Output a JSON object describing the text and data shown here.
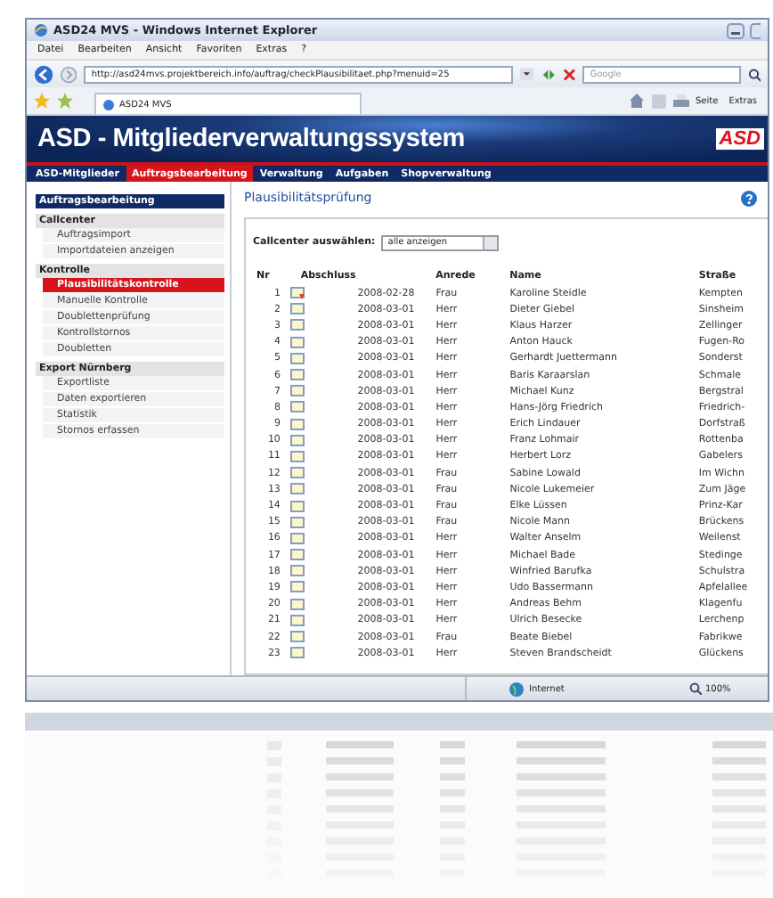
{
  "window": {
    "title": "ASD24 MVS - Windows Internet Explorer"
  },
  "menu": [
    "Datei",
    "Bearbeiten",
    "Ansicht",
    "Favoriten",
    "Extras",
    "?"
  ],
  "address": {
    "url": "http://asd24mvs.projektbereich.info/auftrag/checkPlausibilitaet.php?menuid=25",
    "search_placeholder": "Google"
  },
  "browser_tab": {
    "title": "ASD24 MVS"
  },
  "toolbar": [
    "Seite",
    "Extras"
  ],
  "banner": {
    "title": "ASD - Mitgliederverwaltungssystem",
    "logo": "ASD"
  },
  "nav": [
    {
      "label": "ASD-Mitglieder",
      "selected": false
    },
    {
      "label": "Auftragsbearbeitung",
      "selected": true
    },
    {
      "label": "Verwaltung",
      "selected": false
    },
    {
      "label": "Aufgaben",
      "selected": false
    },
    {
      "label": "Shopverwaltung",
      "selected": false
    }
  ],
  "sidebar": {
    "title": "Auftragsbearbeitung",
    "groups": [
      {
        "label": "Callcenter",
        "items": [
          {
            "label": "Auftragsimport",
            "selected": false
          },
          {
            "label": "Importdateien anzeigen",
            "selected": false
          }
        ]
      },
      {
        "label": "Kontrolle",
        "items": [
          {
            "label": "Plausibilitätskontrolle",
            "selected": true
          },
          {
            "label": "Manuelle Kontrolle",
            "selected": false
          },
          {
            "label": "Doublettenprüfung",
            "selected": false
          },
          {
            "label": "Kontrollstornos",
            "selected": false
          },
          {
            "label": "Doubletten",
            "selected": false
          }
        ]
      },
      {
        "label": "Export Nürnberg",
        "items": [
          {
            "label": "Exportliste",
            "selected": false
          },
          {
            "label": "Daten exportieren",
            "selected": false
          },
          {
            "label": "Statistik",
            "selected": false
          },
          {
            "label": "Stornos erfassen",
            "selected": false
          }
        ]
      }
    ]
  },
  "content": {
    "title": "Plausibilitätsprüfung",
    "filter_label": "Callcenter auswählen:",
    "filter_value": "alle anzeigen"
  },
  "table": {
    "columns": [
      "Nr",
      "Abschluss",
      "Anrede",
      "Name",
      "Straße"
    ],
    "rows": [
      {
        "nr": "1",
        "flagged": true,
        "date": "2008-02-28",
        "salutation": "Frau",
        "name": "Karoline Steidle",
        "street": "Kempten"
      },
      {
        "nr": "2",
        "flagged": false,
        "date": "2008-03-01",
        "salutation": "Herr",
        "name": "Dieter Giebel",
        "street": "Sinsheim"
      },
      {
        "nr": "3",
        "flagged": false,
        "date": "2008-03-01",
        "salutation": "Herr",
        "name": "Klaus Harzer",
        "street": "Zellinger"
      },
      {
        "nr": "4",
        "flagged": false,
        "date": "2008-03-01",
        "salutation": "Herr",
        "name": "Anton Hauck",
        "street": "Fugen-Ro"
      },
      {
        "nr": "5",
        "flagged": false,
        "date": "2008-03-01",
        "salutation": "Herr",
        "name": "Gerhardt Juettermann",
        "street": "Sonderst"
      },
      {
        "nr": "6",
        "flagged": false,
        "date": "2008-03-01",
        "salutation": "Herr",
        "name": "Baris Karaarslan",
        "street": "Schmale"
      },
      {
        "nr": "7",
        "flagged": false,
        "date": "2008-03-01",
        "salutation": "Herr",
        "name": "Michael Kunz",
        "street": "Bergstral"
      },
      {
        "nr": "8",
        "flagged": false,
        "date": "2008-03-01",
        "salutation": "Herr",
        "name": "Hans-Jörg Friedrich",
        "street": "Friedrich-"
      },
      {
        "nr": "9",
        "flagged": false,
        "date": "2008-03-01",
        "salutation": "Herr",
        "name": "Erich Lindauer",
        "street": "Dorfstraß"
      },
      {
        "nr": "10",
        "flagged": false,
        "date": "2008-03-01",
        "salutation": "Herr",
        "name": "Franz Lohmair",
        "street": "Rottenba"
      },
      {
        "nr": "11",
        "flagged": false,
        "date": "2008-03-01",
        "salutation": "Herr",
        "name": "Herbert Lorz",
        "street": "Gabelers"
      },
      {
        "nr": "12",
        "flagged": false,
        "date": "2008-03-01",
        "salutation": "Frau",
        "name": "Sabine Lowald",
        "street": "Im Wichn"
      },
      {
        "nr": "13",
        "flagged": false,
        "date": "2008-03-01",
        "salutation": "Frau",
        "name": "Nicole Lukemeier",
        "street": "Zum Jäge"
      },
      {
        "nr": "14",
        "flagged": false,
        "date": "2008-03-01",
        "salutation": "Frau",
        "name": "Elke Lüssen",
        "street": "Prinz-Kar"
      },
      {
        "nr": "15",
        "flagged": false,
        "date": "2008-03-01",
        "salutation": "Frau",
        "name": "Nicole Mann",
        "street": "Brückens"
      },
      {
        "nr": "16",
        "flagged": false,
        "date": "2008-03-01",
        "salutation": "Herr",
        "name": "Walter Anselm",
        "street": "Weilenst"
      },
      {
        "nr": "17",
        "flagged": false,
        "date": "2008-03-01",
        "salutation": "Herr",
        "name": "Michael Bade",
        "street": "Stedinge"
      },
      {
        "nr": "18",
        "flagged": false,
        "date": "2008-03-01",
        "salutation": "Herr",
        "name": "Winfried Barufka",
        "street": "Schulstra"
      },
      {
        "nr": "19",
        "flagged": false,
        "date": "2008-03-01",
        "salutation": "Herr",
        "name": "Udo Bassermann",
        "street": "Apfelallee"
      },
      {
        "nr": "20",
        "flagged": false,
        "date": "2008-03-01",
        "salutation": "Herr",
        "name": "Andreas Behm",
        "street": "Klagenfu"
      },
      {
        "nr": "21",
        "flagged": false,
        "date": "2008-03-01",
        "salutation": "Herr",
        "name": "Ulrich Besecke",
        "street": "Lerchenp"
      },
      {
        "nr": "22",
        "flagged": false,
        "date": "2008-03-01",
        "salutation": "Frau",
        "name": "Beate Biebel",
        "street": "Fabrikwe"
      },
      {
        "nr": "23",
        "flagged": false,
        "date": "2008-03-01",
        "salutation": "Herr",
        "name": "Steven Brandscheidt",
        "street": "Glückens"
      }
    ]
  },
  "status_bar": {
    "zone": "Internet",
    "zoom": "100%"
  }
}
